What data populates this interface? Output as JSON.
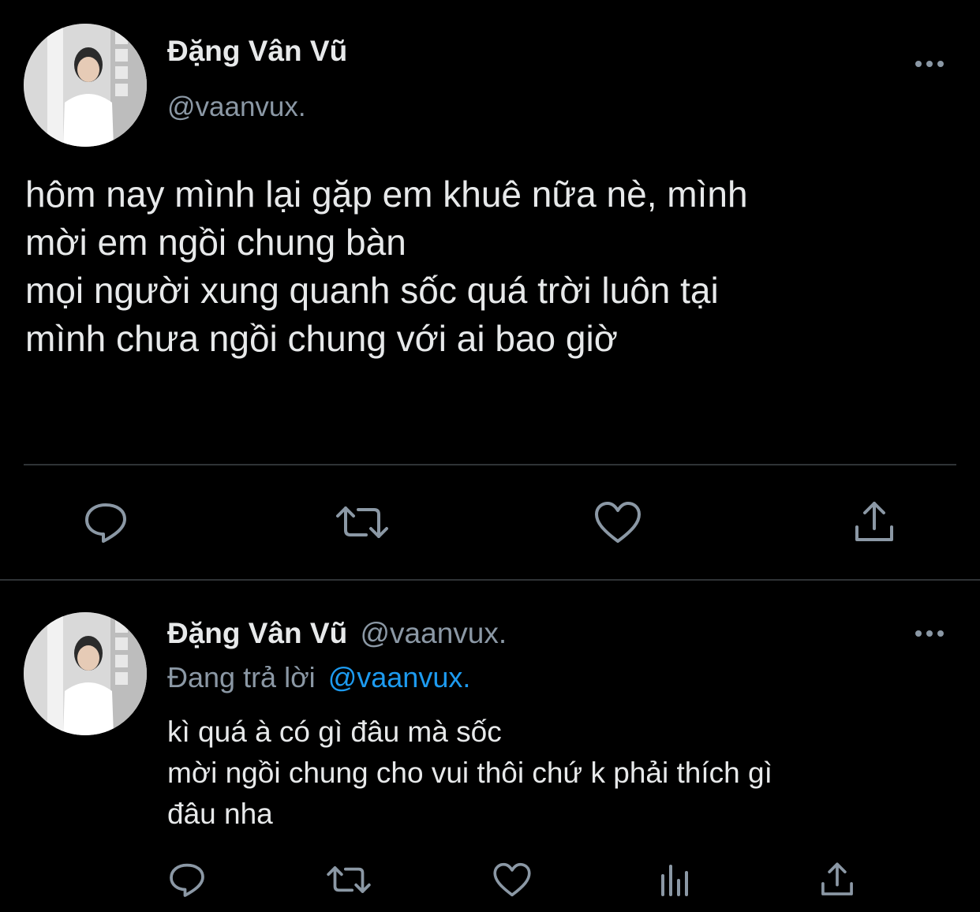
{
  "main_tweet": {
    "author_name": "Đặng Vân Vũ",
    "handle": "@vaanvux.",
    "text": "hôm nay mình lại gặp em khuê nữa nè, mình\nmời em ngồi chung bàn\nmọi người xung quanh sốc quá trời luôn tại\nmình chưa ngồi chung với ai bao giờ",
    "actions": [
      "reply-icon",
      "retweet-icon",
      "like-icon",
      "share-icon"
    ]
  },
  "reply_tweet": {
    "author_name": "Đặng Vân Vũ",
    "handle": "@vaanvux.",
    "replying_prefix": "Đang trả lời",
    "replying_to": "@vaanvux.",
    "text": "kì quá à có gì đâu mà sốc\nmời ngồi chung cho vui thôi chứ k phải thích gì\nđâu nha",
    "actions": [
      "reply-icon",
      "retweet-icon",
      "like-icon",
      "analytics-icon",
      "share-icon"
    ]
  },
  "colors": {
    "background": "#000000",
    "text": "#e7e9ea",
    "muted": "#8b98a5",
    "link": "#1d9bf0",
    "divider": "#2f3336"
  }
}
